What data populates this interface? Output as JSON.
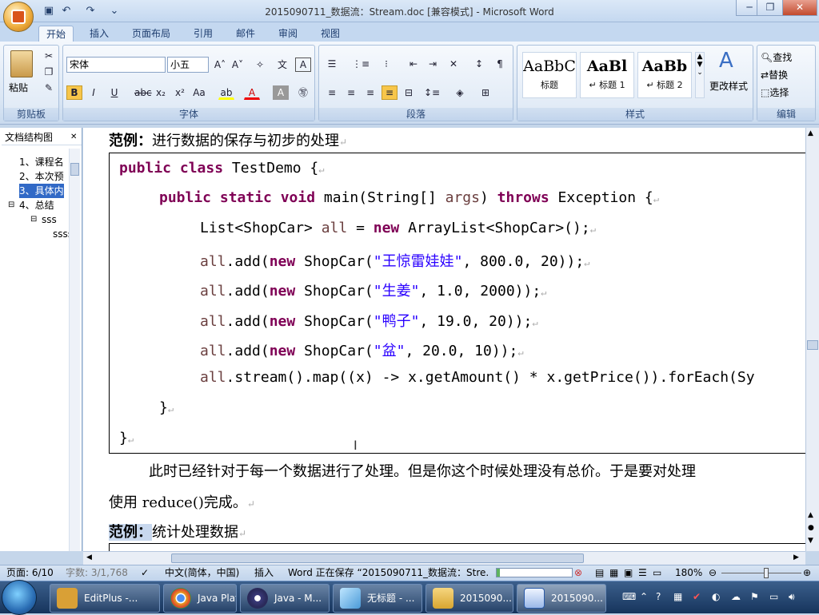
{
  "window": {
    "title": "2015090711_数据流：Stream.doc [兼容模式] - Microsoft Word"
  },
  "tabs": [
    "开始",
    "插入",
    "页面布局",
    "引用",
    "邮件",
    "审阅",
    "视图"
  ],
  "ribbon": {
    "clipboard": {
      "label": "剪贴板",
      "paste": "粘贴"
    },
    "font": {
      "label": "字体",
      "family": "宋体",
      "size": "小五"
    },
    "paragraph": {
      "label": "段落"
    },
    "styles": {
      "label": "样式",
      "items": [
        {
          "preview": "AaBbC",
          "name": "标题"
        },
        {
          "preview": "AaBl",
          "name": "↵ 标题 1"
        },
        {
          "preview": "AaBb",
          "name": "↵ 标题 2"
        }
      ],
      "change": "更改样式"
    },
    "editing": {
      "label": "编辑",
      "find": "查找",
      "replace": "替换",
      "select": "选择"
    }
  },
  "nav": {
    "view": "文档结构图",
    "items": [
      "1、课程名",
      "2、本次预",
      "3、具体内",
      "4、总结",
      "sss",
      "ssss"
    ]
  },
  "document": {
    "heading1_bold": "范例：",
    "heading1_text": "进行数据的保存与初步的处理",
    "code": {
      "l1a": "public class ",
      "l1b": "TestDemo {",
      "l2a": "public static void ",
      "l2b": "main(String[] ",
      "l2c": "args",
      "l2d": ") ",
      "l2e": "throws ",
      "l2f": "Exception {",
      "l3a": "List<ShopCar> ",
      "l3b": "all",
      "l3c": " = ",
      "l3d": "new ",
      "l3e": "ArrayList<ShopCar>();",
      "adds": [
        {
          "name": "\"王惊雷娃娃\"",
          "rest": ", 800.0, 20));"
        },
        {
          "name": "\"生姜\"",
          "rest": ", 1.0, 2000));"
        },
        {
          "name": "\"鸭子\"",
          "rest": ", 19.0, 20));"
        },
        {
          "name": "\"盆\"",
          "rest": ", 20.0, 10));"
        }
      ],
      "add_prefix": "all",
      "add_mid": ".add(",
      "add_new": "new ",
      "add_cls": "ShopCar(",
      "stream": ".stream().map((x) -> x.getAmount() * x.getPrice()).forEach(Sy",
      "close_inner": "}",
      "close_outer": "}"
    },
    "para1": "此时已经针对于每一个数据进行了处理。但是你这个时候处理没有总价。于是要对处理",
    "para2": "使用 reduce()完成。",
    "heading2_bold": "范例：",
    "heading2_text": "统计处理数据"
  },
  "status": {
    "page": "页面: 6/10",
    "words": "字数: 3/1,768",
    "language": "中文(简体，中国)",
    "mode": "插入",
    "saving": "Word 正在保存 “2015090711_数据流：Stre...",
    "zoom": "180%"
  },
  "taskbar": {
    "items": [
      "EditPlus -...",
      "Java Platf...",
      "Java - M...",
      "无标题 - ...",
      "2015090...",
      "2015090..."
    ],
    "time": ""
  }
}
